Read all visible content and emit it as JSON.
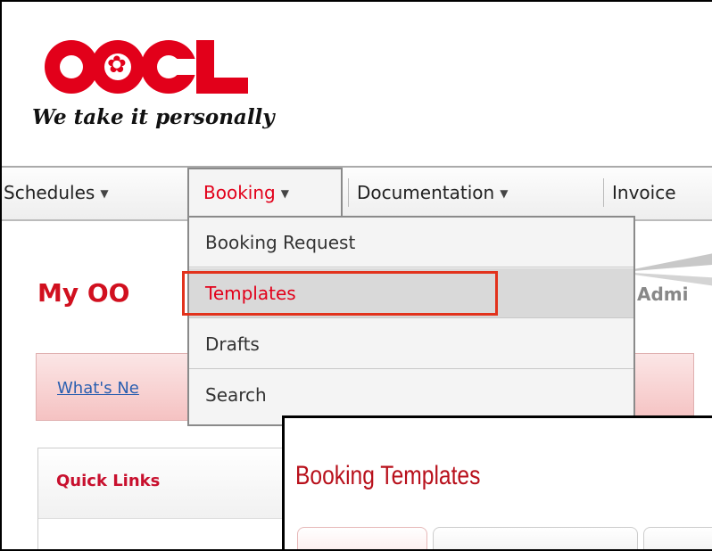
{
  "brand": {
    "logo_text": "OOCL",
    "tagline": "We take it personally",
    "color": "#e2001a"
  },
  "nav": {
    "items": [
      {
        "label": "Schedules"
      },
      {
        "label": "Booking"
      },
      {
        "label": "Documentation"
      },
      {
        "label": "Invoice"
      }
    ],
    "active": "Booking"
  },
  "dropdown": {
    "items": [
      {
        "label": "Booking Request"
      },
      {
        "label": "Templates"
      },
      {
        "label": "Drafts"
      },
      {
        "label": "Search"
      }
    ],
    "selected": "Templates"
  },
  "page": {
    "title": "My OO",
    "admin_fragment": "Admi",
    "whats_new_link": "What's Ne",
    "quick_links": "Quick Links"
  },
  "popup": {
    "title": "Booking Templates"
  }
}
